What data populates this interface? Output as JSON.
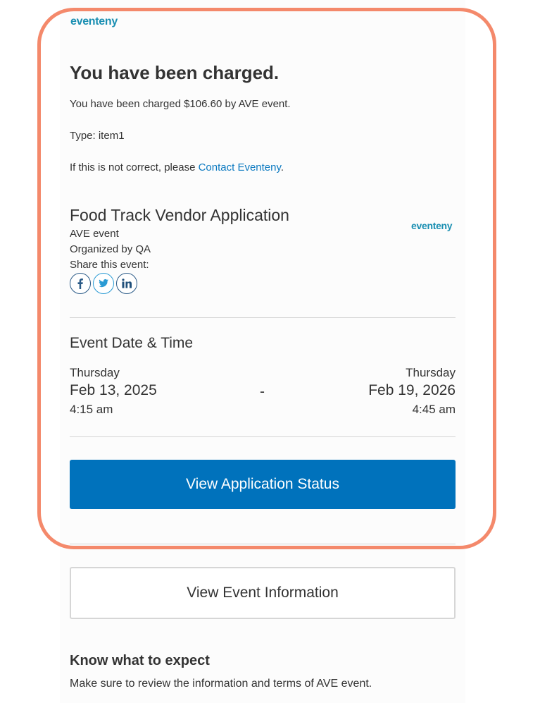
{
  "brand": {
    "logo_text": "eventeny",
    "logo_color": "#1a8fb2",
    "accent_color": "#0072bc",
    "highlight_color": "#f4896b"
  },
  "charge": {
    "heading": "You have been charged.",
    "amount_text": "You have been charged $106.60 by AVE event.",
    "type_text": "Type: item1",
    "incorrect_prefix": "If this is not correct, please ",
    "contact_link": "Contact Eventeny",
    "incorrect_suffix": "."
  },
  "event": {
    "title": "Food Track Vendor Application",
    "name": "AVE event",
    "organizer": "Organized by QA",
    "share_label": "Share this event:",
    "social_icons": [
      "facebook-icon",
      "twitter-icon",
      "linkedin-icon"
    ]
  },
  "datetime": {
    "section_title": "Event Date & Time",
    "start": {
      "day": "Thursday",
      "date": "Feb 13, 2025",
      "time": "4:15 am"
    },
    "separator": "-",
    "end": {
      "day": "Thursday",
      "date": "Feb 19, 2026",
      "time": "4:45 am"
    }
  },
  "actions": {
    "primary_label": "View Application Status",
    "secondary_label": "View Event Information"
  },
  "expect": {
    "title": "Know what to expect",
    "text": "Make sure to review the information and terms of AVE event."
  }
}
